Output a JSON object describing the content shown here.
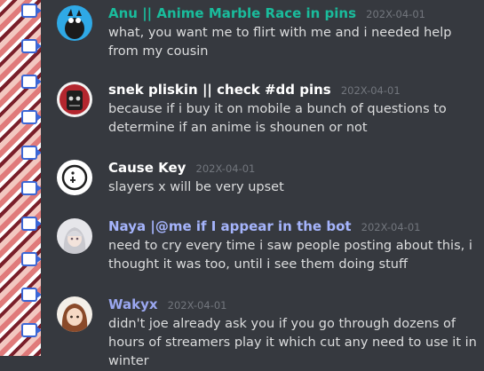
{
  "messages": [
    {
      "author": "Anu || Anime Marble Race in pins",
      "timestamp": "202X-04-01",
      "text": "what, you want me to flirt with me and i needed help from my cousin",
      "author_color": "#1abc9c"
    },
    {
      "author": "snek pliskin || check #dd pins",
      "timestamp": "202X-04-01",
      "text": "because if i buy it on mobile a bunch of questions to determine if an anime is shounen or not",
      "author_color": "#ffffff"
    },
    {
      "author": "Cause Key",
      "timestamp": "202X-04-01",
      "text": "slayers x will be very upset",
      "author_color": "#ffffff"
    },
    {
      "author": "Naya |@me if I appear in the bot",
      "timestamp": "202X-04-01",
      "text": "need to cry every time i saw people posting about this, i thought it was too, until i see them doing stuff",
      "author_color": "#a5b4fc"
    },
    {
      "author": "Wakyx",
      "timestamp": "202X-04-01",
      "text": "didn't joe already ask you if you go through dozens of hours of streamers play it which cut any need to use it in winter",
      "author_color": "#9aa7f0"
    }
  ],
  "colors": {
    "background": "#36393f",
    "text": "#dcddde",
    "timestamp": "#72767d"
  }
}
